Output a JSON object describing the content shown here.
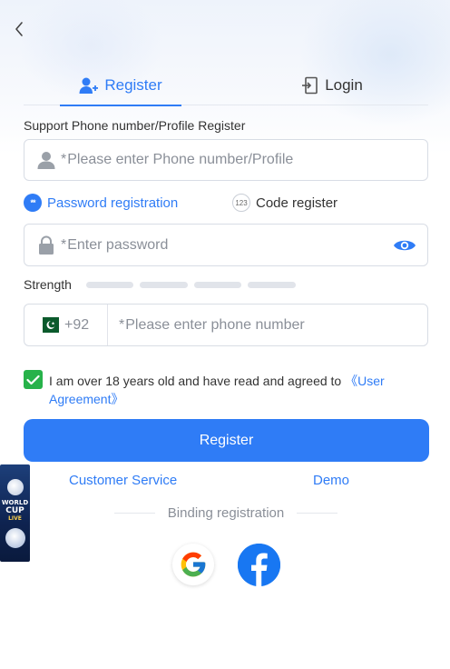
{
  "header": {
    "back_icon": "chevron-left-icon"
  },
  "tabs": {
    "register_label": "Register",
    "login_label": "Login",
    "active": "register"
  },
  "form": {
    "support_label": "Support Phone number/Profile Register",
    "phone_profile_required": "*",
    "phone_profile_placeholder": "Please enter Phone number/Profile",
    "mode_password_label": "Password registration",
    "mode_password_icon_text": "**",
    "mode_code_label": "Code register",
    "mode_code_icon_text": "123",
    "password_required": "*",
    "password_placeholder": "Enter password",
    "strength_label": "Strength",
    "strength_level": 0,
    "country_dial_code": "+92",
    "mobile_required": "*",
    "mobile_placeholder": "Please enter phone number",
    "agree_checked": true,
    "agree_text": "I am over 18 years old and have read and agreed to ",
    "agree_link": "《User Agreement》"
  },
  "actions": {
    "register_button": "Register",
    "customer_service": "Customer Service",
    "demo": "Demo",
    "binding_label": "Binding registration"
  },
  "social": [
    "google-icon",
    "facebook-icon"
  ],
  "promo": {
    "line1": "WORLD",
    "line2": "CUP",
    "line3": "LIVE"
  },
  "colors": {
    "accent": "#2f7cf6",
    "checkbox": "#27b24a",
    "facebook": "#1877f2"
  }
}
